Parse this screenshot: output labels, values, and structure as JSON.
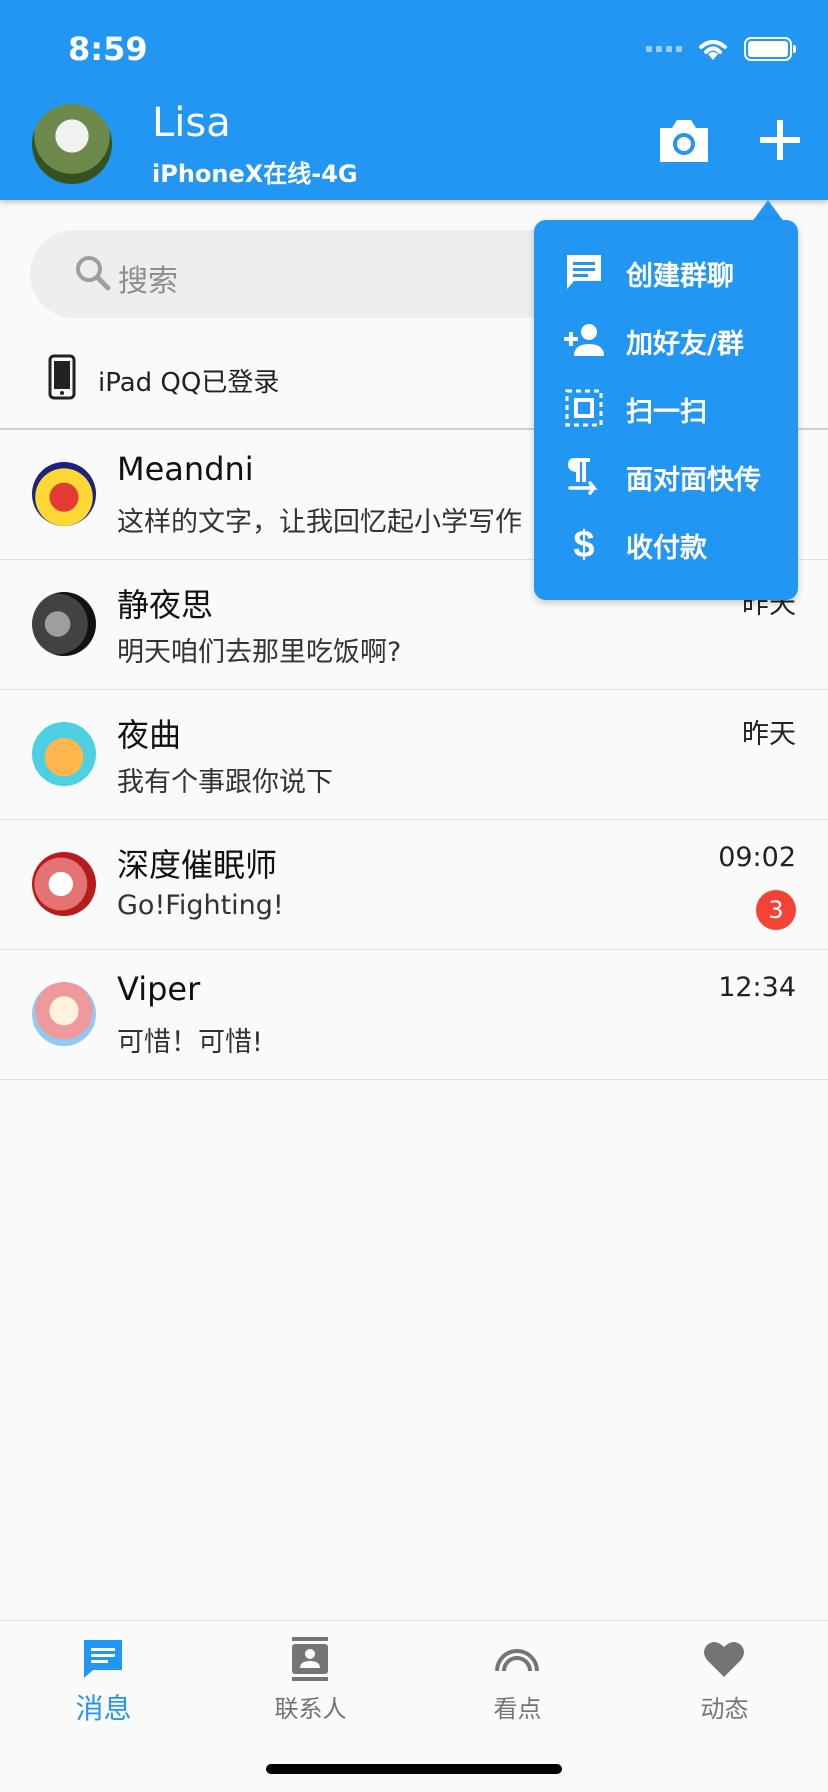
{
  "status_bar": {
    "time": "8:59"
  },
  "header": {
    "user_name": "Lisa",
    "user_status": "iPhoneX在线-4G",
    "accent_color": "#2196f3"
  },
  "search": {
    "placeholder": "搜索"
  },
  "device_login": {
    "text": "iPad QQ已登录"
  },
  "chats": [
    {
      "name": "Meandni",
      "message": "这样的文字，让我回忆起小学写作",
      "time": "",
      "badge": ""
    },
    {
      "name": "静夜思",
      "message": "明天咱们去那里吃饭啊?",
      "time": "昨天",
      "badge": ""
    },
    {
      "name": "夜曲",
      "message": "我有个事跟你说下",
      "time": "昨天",
      "badge": ""
    },
    {
      "name": "深度催眠师",
      "message": "Go!Fighting!",
      "time": "09:02",
      "badge": "3"
    },
    {
      "name": "Viper",
      "message": "可惜！可惜!",
      "time": "12:34",
      "badge": ""
    }
  ],
  "popup_menu": {
    "items": [
      {
        "label": "创建群聊",
        "icon": "chat-icon"
      },
      {
        "label": "加好友/群",
        "icon": "add-person-icon"
      },
      {
        "label": "扫一扫",
        "icon": "scan-icon"
      },
      {
        "label": "面对面快传",
        "icon": "face-transfer-icon"
      },
      {
        "label": "收付款",
        "icon": "dollar-icon"
      }
    ]
  },
  "bottom_nav": {
    "items": [
      {
        "label": "消息",
        "icon": "message-icon",
        "active": true
      },
      {
        "label": "联系人",
        "icon": "contacts-icon",
        "active": false
      },
      {
        "label": "看点",
        "icon": "rainbow-icon",
        "active": false
      },
      {
        "label": "动态",
        "icon": "heart-icon",
        "active": false
      }
    ]
  }
}
